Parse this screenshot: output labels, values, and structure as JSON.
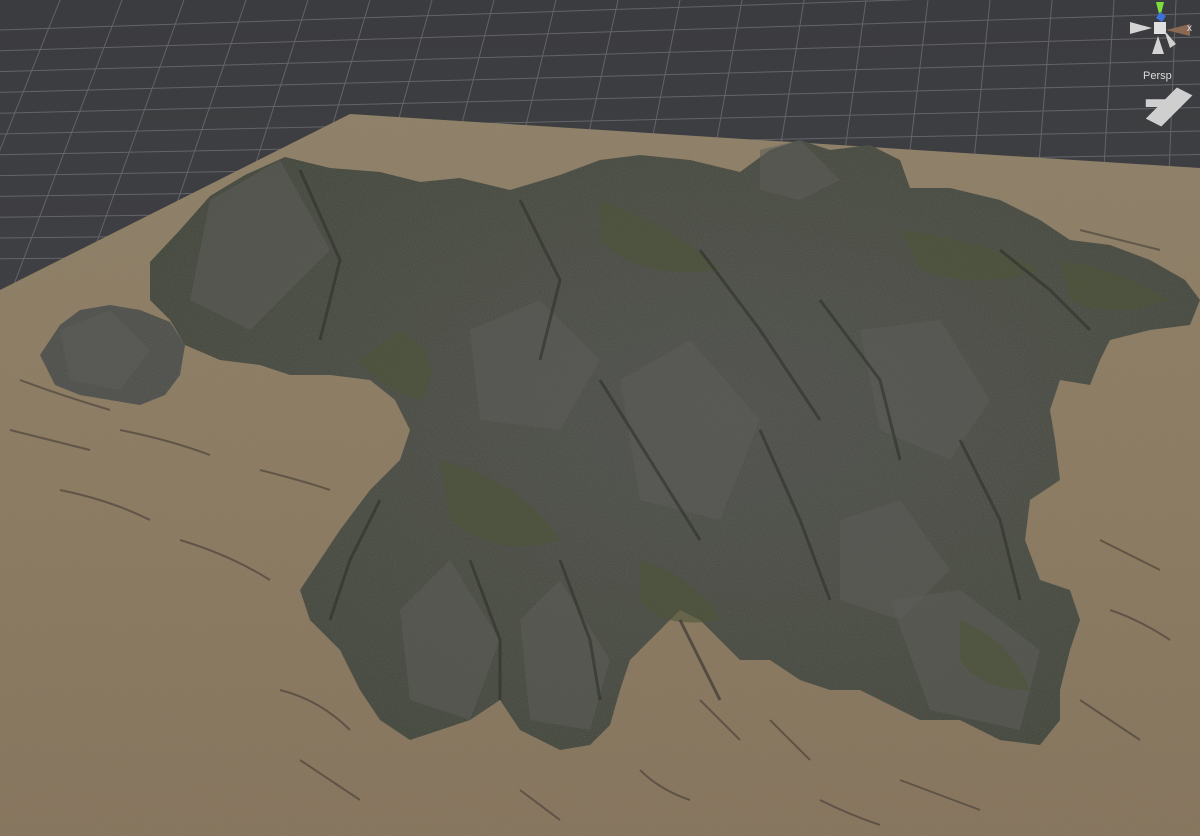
{
  "app": {
    "view": "scene-view"
  },
  "scene": {
    "grid_color": "#6f7074",
    "background_color": "#3d3e41",
    "ground_color": "#8c7a60",
    "rock_color": "#4e4e4c",
    "moss_color": "#454a35"
  },
  "gizmo": {
    "axis_x_label": "x",
    "projection_label": "Persp",
    "projection_icon": "lock-icon",
    "colors": {
      "y_axis": "#7be03c",
      "z_axis": "#3d71d9",
      "x_axis": "#8a6a55"
    }
  }
}
